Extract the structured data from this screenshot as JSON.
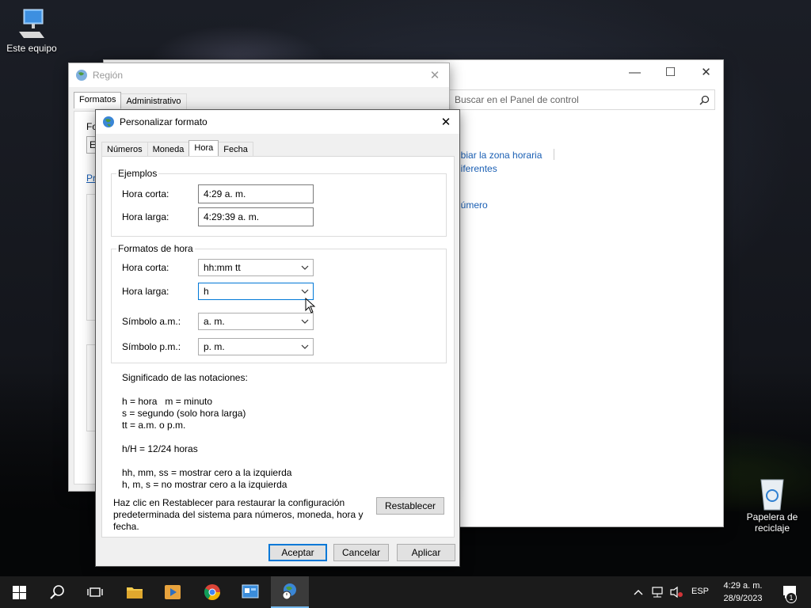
{
  "desktop": {
    "this_pc_label": "Este equipo",
    "recycle_bin_label_line1": "Papelera de",
    "recycle_bin_label_line2": "reciclaje"
  },
  "control_panel": {
    "search_placeholder": "Buscar en el Panel de control",
    "link_timezone": "nbiar la zona horaria",
    "link_diferentes": "diferentes",
    "link_numero": "número"
  },
  "region_window": {
    "title": "Región",
    "tab_formats": "Formatos",
    "tab_admin": "Administrativo",
    "partial_label": "Fo",
    "partial_combo": "E",
    "partial_link": "Pr"
  },
  "customize_dialog": {
    "title": "Personalizar formato",
    "tabs": [
      "Números",
      "Moneda",
      "Hora",
      "Fecha"
    ],
    "active_tab": "Hora",
    "examples": {
      "legend": "Ejemplos",
      "short_time_label": "Hora corta:",
      "short_time_value": "4:29 a. m.",
      "long_time_label": "Hora larga:",
      "long_time_value": "4:29:39 a. m."
    },
    "formats": {
      "legend": "Formatos de hora",
      "short_time_label": "Hora corta:",
      "short_time_value": "hh:mm tt",
      "long_time_label": "Hora larga:",
      "long_time_value": "h",
      "am_label": "Símbolo a.m.:",
      "am_value": "a. m.",
      "pm_label": "Símbolo p.m.:",
      "pm_value": "p. m."
    },
    "notation": {
      "heading": "Significado de las notaciones:",
      "line1": "h = hora   m = minuto",
      "line2": "s = segundo (solo hora larga)",
      "line3": "tt = a.m. o p.m.",
      "line4": "h/H = 12/24 horas",
      "line5": "hh, mm, ss = mostrar cero a la izquierda",
      "line6": "h, m, s = no mostrar cero a la izquierda"
    },
    "reset_text_line1": "Haz clic en Restablecer para restaurar la configuración",
    "reset_text_line2": "predeterminada del sistema para números, moneda, hora y",
    "reset_text_line3": "fecha.",
    "reset_button": "Restablecer",
    "ok_button": "Aceptar",
    "cancel_button": "Cancelar",
    "apply_button": "Aplicar"
  },
  "taskbar": {
    "language": "ESP",
    "time": "4:29 a. m.",
    "date": "28/9/2023",
    "notification_count": "1"
  },
  "colors": {
    "accent": "#0078d7",
    "link": "#1a5fb4",
    "taskbar": "#1b1b1b"
  }
}
